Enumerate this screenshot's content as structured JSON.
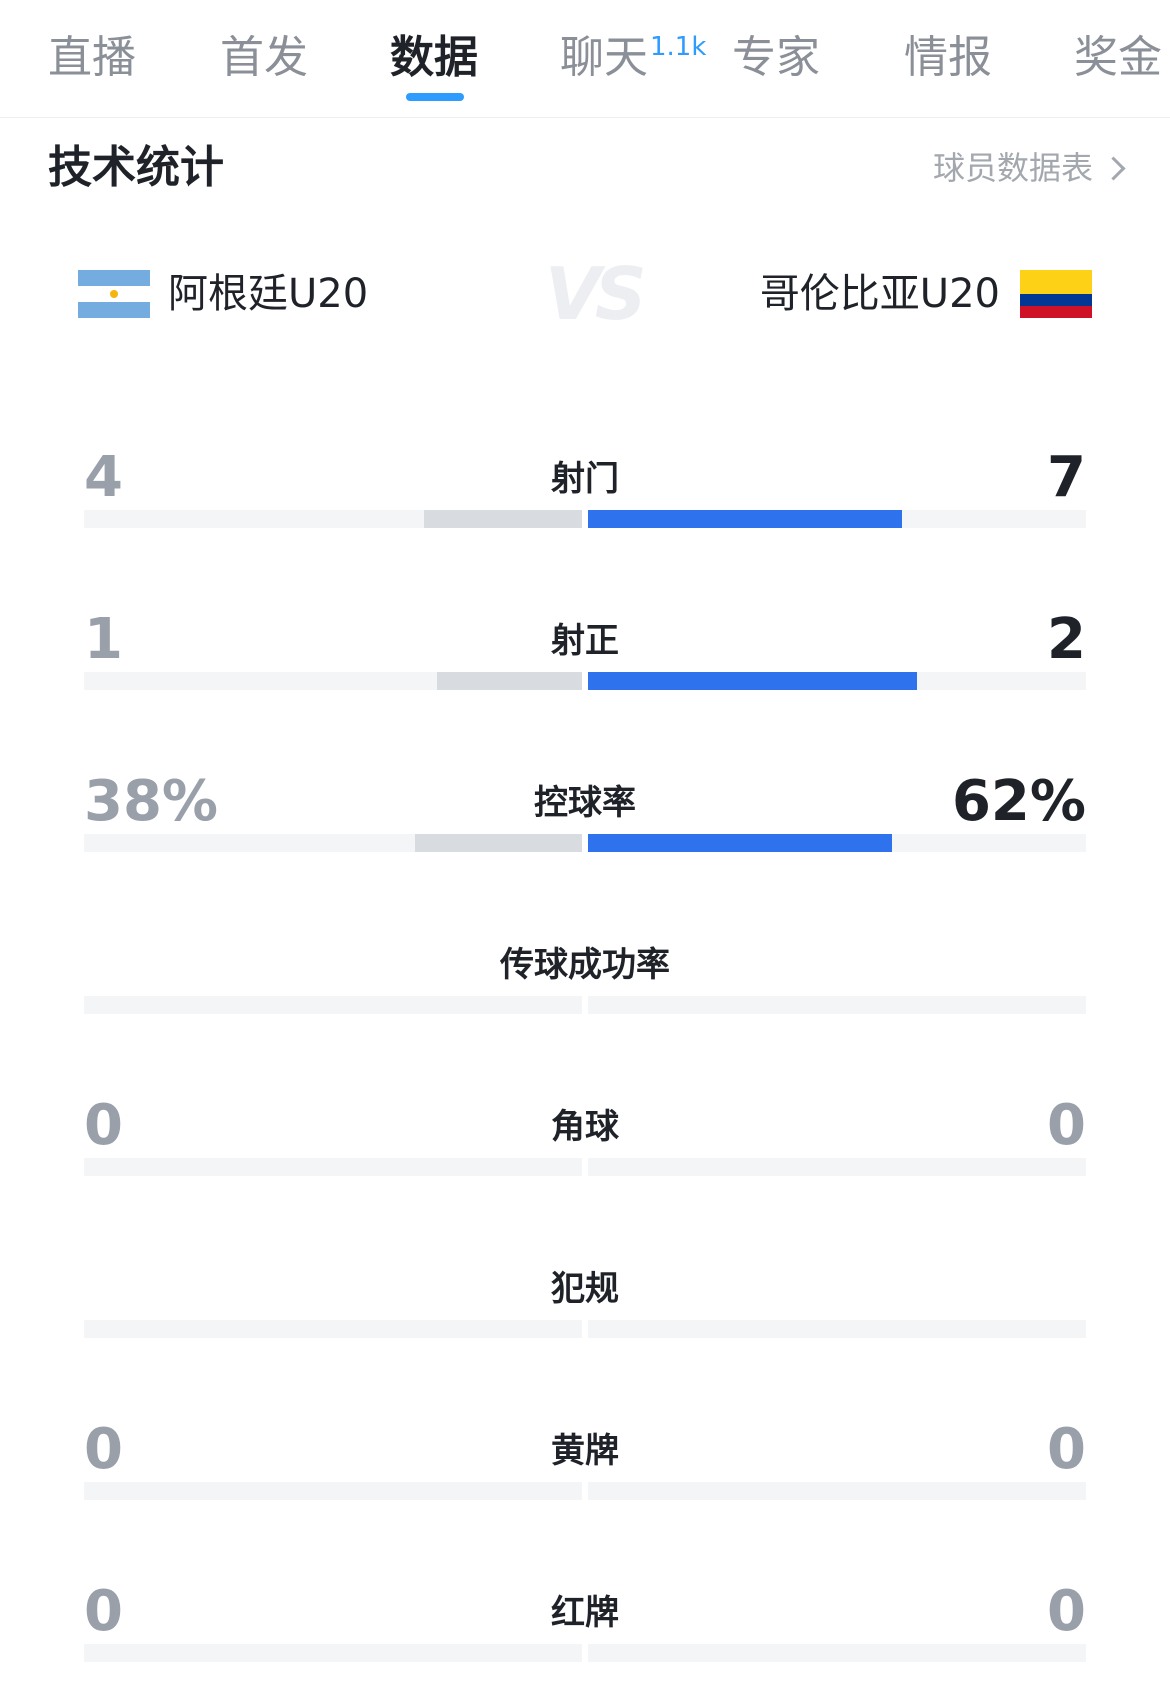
{
  "tabs": [
    {
      "label": "直播"
    },
    {
      "label": "首发"
    },
    {
      "label": "数据",
      "active": true
    },
    {
      "label": "聊天",
      "badge": "1.1k"
    },
    {
      "label": "专家"
    },
    {
      "label": "情报"
    },
    {
      "label": "奖金"
    }
  ],
  "section": {
    "title": "技术统计",
    "player_link": "球员数据表"
  },
  "match": {
    "home_team": "阿根廷U20",
    "away_team": "哥伦比亚U20",
    "vs": "VS",
    "home_flag": "argentina-flag",
    "away_flag": "colombia-flag"
  },
  "colors": {
    "accent": "#2e9bff",
    "away_bar": "#2e72ee",
    "home_bar": "#d8dbe0",
    "track": "#f4f5f7"
  },
  "stats": [
    {
      "label": "射门",
      "home": "4",
      "away": "7",
      "home_fraction": 0.36,
      "away_fraction": 0.64
    },
    {
      "label": "射正",
      "home": "1",
      "away": "2",
      "home_fraction": 0.33,
      "away_fraction": 0.67
    },
    {
      "label": "控球率",
      "home": "38%",
      "away": "62%",
      "home_fraction": 0.38,
      "away_fraction": 0.62
    },
    {
      "label": "传球成功率",
      "home": "",
      "away": "",
      "home_fraction": 0,
      "away_fraction": 0
    },
    {
      "label": "角球",
      "home": "0",
      "away": "0",
      "home_fraction": 0,
      "away_fraction": 0
    },
    {
      "label": "犯规",
      "home": "",
      "away": "",
      "home_fraction": 0,
      "away_fraction": 0
    },
    {
      "label": "黄牌",
      "home": "0",
      "away": "0",
      "home_fraction": 0,
      "away_fraction": 0
    },
    {
      "label": "红牌",
      "home": "0",
      "away": "0",
      "home_fraction": 0,
      "away_fraction": 0
    }
  ]
}
